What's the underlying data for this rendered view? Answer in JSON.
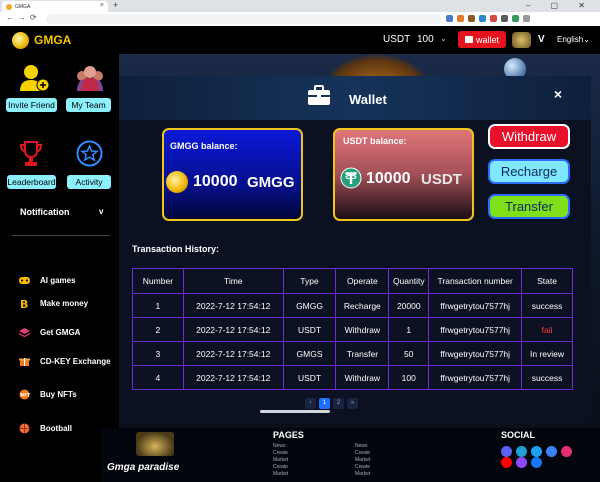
{
  "browser": {
    "tab_title": "GMGA",
    "tab_close": "×",
    "new_tab": "+",
    "window_controls": "– ▢ ✕",
    "url": ""
  },
  "header": {
    "logo_text": "GMGA",
    "currency": "USDT",
    "amount": "100",
    "chevron": "⌄",
    "wallet_label": "wallet",
    "user_initial": "V",
    "language": "English",
    "language_chevron": "⌄"
  },
  "sidebar": {
    "invite_label": "Invite Friend",
    "team_label": "My Team",
    "leaderboard_label": "Leaderboard",
    "activity_label": "Activity",
    "notification_label": "Notification",
    "notification_chevron": "v",
    "menu": [
      {
        "label": "AI games"
      },
      {
        "label": "Make money"
      },
      {
        "label": "Get GMGA"
      },
      {
        "label": "CD-KEY Exchange"
      },
      {
        "label": "Buy NFTs"
      },
      {
        "label": "Bootball"
      }
    ]
  },
  "wallet_modal": {
    "title": "Wallet",
    "close": "×",
    "gmgg_card": {
      "label": "GMGG balance:",
      "amount": "10000",
      "unit": "GMGG"
    },
    "usdt_card": {
      "label": "USDT balance:",
      "amount": "10000",
      "unit": "USDT"
    },
    "buttons": {
      "withdraw": "Withdraw",
      "recharge": "Recharge",
      "transfer": "Transfer"
    },
    "history_title": "Transaction History:",
    "columns": [
      "Number",
      "Time",
      "Type",
      "Operate",
      "Quantity",
      "Transaction number",
      "State"
    ],
    "rows": [
      [
        "1",
        "2022-7-12 17:54:12",
        "GMGG",
        "Recharge",
        "20000",
        "ffrwgetrytou7577hj",
        "success"
      ],
      [
        "2",
        "2022-7-12 17:54:12",
        "USDT",
        "Withdraw",
        "1",
        "ffrwgetrytou7577hj",
        "fail"
      ],
      [
        "3",
        "2022-7-12 17:54:12",
        "GMGS",
        "Transfer",
        "50",
        "ffrwgetrytou7577hj",
        "In review"
      ],
      [
        "4",
        "2022-7-12 17:54:12",
        "USDT",
        "Withdraw",
        "100",
        "ffrwgetrytou7577hj",
        "success"
      ]
    ],
    "state_colors": {
      "success": "#ffffff",
      "fail": "#ff3b3b",
      "In review": "#ffffff"
    },
    "pager": {
      "prev": "‹",
      "current": "1",
      "next_page": "2",
      "next": "»"
    }
  },
  "footer": {
    "brand": "Gmga paradise",
    "pages_heading": "PAGES",
    "social_heading": "SOCIAL",
    "links_col1": [
      "News",
      "Create",
      "Market",
      "Create",
      "Market"
    ],
    "links_col2": [
      "News",
      "Create",
      "Market",
      "Create",
      "Market"
    ]
  },
  "colors": {
    "accent_yellow": "#f7c600",
    "wallet_red": "#e3141e",
    "table_border": "#6b2bd8",
    "pill_cyan": "#8cf0ff"
  }
}
